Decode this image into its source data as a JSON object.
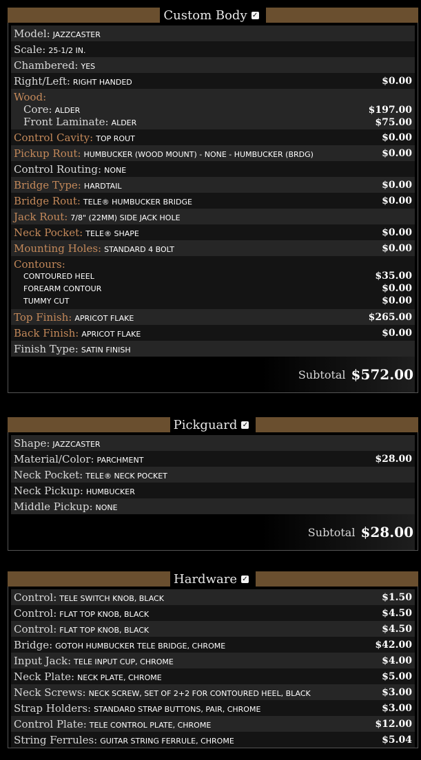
{
  "sections": [
    {
      "title": "Custom Body",
      "rows": [
        {
          "label": "Model:",
          "value": "JAZZCASTER",
          "price": "",
          "hl": false
        },
        {
          "label": "Scale:",
          "value": "25-1/2 IN.",
          "price": "",
          "hl": false
        },
        {
          "label": "Chambered:",
          "value": "YES",
          "price": "",
          "hl": false
        },
        {
          "label": "Right/Left:",
          "value": "RIGHT HANDED",
          "price": "$0.00",
          "hl": false
        },
        {
          "label": "Wood:",
          "hl": true,
          "sub": [
            {
              "label": "Core:",
              "value": "ALDER",
              "price": "$197.00"
            },
            {
              "label": "Front Laminate:",
              "value": "ALDER",
              "price": "$75.00"
            }
          ]
        },
        {
          "label": "Control Cavity:",
          "value": "TOP ROUT",
          "price": "$0.00",
          "hl": true
        },
        {
          "label": "Pickup Rout:",
          "value": "HUMBUCKER (WOOD MOUNT) - NONE - HUMBUCKER (BRDG)",
          "price": "$0.00",
          "hl": true
        },
        {
          "label": "Control Routing:",
          "value": "NONE",
          "price": "",
          "hl": false
        },
        {
          "label": "Bridge Type:",
          "value": "HARDTAIL",
          "price": "$0.00",
          "hl": true
        },
        {
          "label": "Bridge Rout:",
          "value": "TELE® HUMBUCKER BRIDGE",
          "price": "$0.00",
          "hl": true
        },
        {
          "label": "Jack Rout:",
          "value": "7/8\" (22MM) SIDE JACK HOLE",
          "price": "",
          "hl": true
        },
        {
          "label": "Neck Pocket:",
          "value": "TELE® SHAPE",
          "price": "$0.00",
          "hl": true
        },
        {
          "label": "Mounting Holes:",
          "value": "STANDARD 4 BOLT",
          "price": "$0.00",
          "hl": true
        },
        {
          "label": "Contours:",
          "hl": true,
          "plain": [
            {
              "value": "CONTOURED HEEL",
              "price": "$35.00"
            },
            {
              "value": "FOREARM CONTOUR",
              "price": "$0.00"
            },
            {
              "value": "TUMMY CUT",
              "price": "$0.00"
            }
          ]
        },
        {
          "label": "Top Finish:",
          "value": "APRICOT FLAKE",
          "price": "$265.00",
          "hl": true
        },
        {
          "label": "Back Finish:",
          "value": "APRICOT FLAKE",
          "price": "$0.00",
          "hl": true
        },
        {
          "label": "Finish Type:",
          "value": "SATIN FINISH",
          "price": "",
          "hl": false
        }
      ],
      "subtotal_label": "Subtotal",
      "subtotal": "$572.00"
    },
    {
      "title": "Pickguard",
      "rows": [
        {
          "label": "Shape:",
          "value": "JAZZCASTER",
          "price": "",
          "hl": false
        },
        {
          "label": "Material/Color:",
          "value": "PARCHMENT",
          "price": "$28.00",
          "hl": false
        },
        {
          "label": "Neck Pocket:",
          "value": "TELE® NECK POCKET",
          "price": "",
          "hl": false
        },
        {
          "label": "Neck Pickup:",
          "value": "HUMBUCKER",
          "price": "",
          "hl": false
        },
        {
          "label": "Middle Pickup:",
          "value": "NONE",
          "price": "",
          "hl": false
        }
      ],
      "subtotal_label": "Subtotal",
      "subtotal": "$28.00"
    },
    {
      "title": "Hardware",
      "rows": [
        {
          "label": "Control:",
          "value": "TELE SWITCH KNOB, BLACK",
          "price": "$1.50",
          "hl": false
        },
        {
          "label": "Control:",
          "value": "FLAT TOP KNOB, BLACK",
          "price": "$4.50",
          "hl": false
        },
        {
          "label": "Control:",
          "value": "FLAT TOP KNOB, BLACK",
          "price": "$4.50",
          "hl": false
        },
        {
          "label": "Bridge:",
          "value": "GOTOH HUMBUCKER TELE BRIDGE, CHROME",
          "price": "$42.00",
          "hl": false
        },
        {
          "label": "Input Jack:",
          "value": "TELE INPUT CUP, CHROME",
          "price": "$4.00",
          "hl": false
        },
        {
          "label": "Neck Plate:",
          "value": "NECK PLATE, CHROME",
          "price": "$5.00",
          "hl": false
        },
        {
          "label": "Neck Screws:",
          "value": "NECK SCREW, SET OF 2+2 FOR CONTOURED HEEL, BLACK",
          "price": "$3.00",
          "hl": false
        },
        {
          "label": "Strap Holders:",
          "value": "STANDARD STRAP BUTTONS, PAIR, CHROME",
          "price": "$3.00",
          "hl": false
        },
        {
          "label": "Control Plate:",
          "value": "TELE CONTROL PLATE, CHROME",
          "price": "$12.00",
          "hl": false
        },
        {
          "label": "String Ferrules:",
          "value": "GUITAR STRING FERRULE, CHROME",
          "price": "$5.04",
          "hl": false
        }
      ]
    }
  ],
  "colors": {
    "accent": "#c4895a",
    "header_bar": "#6a4f2f"
  }
}
